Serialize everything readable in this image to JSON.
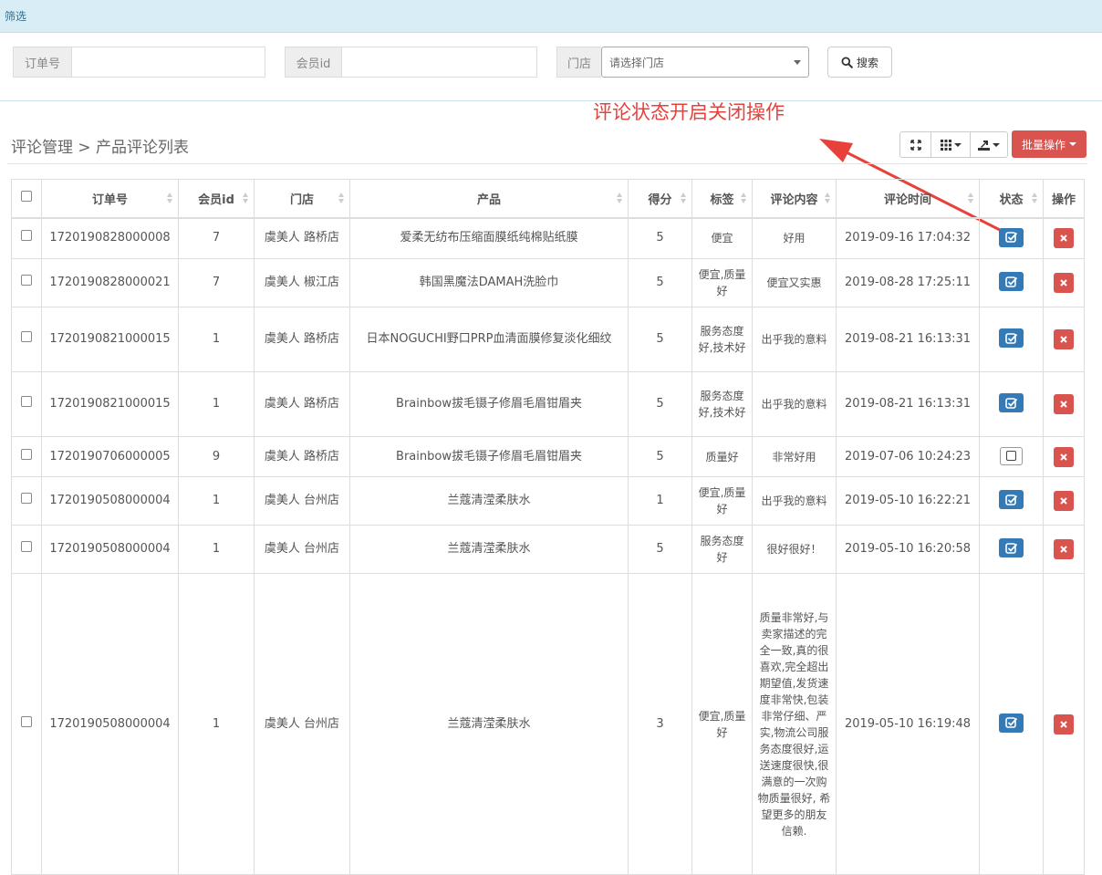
{
  "filter": {
    "header": "筛选",
    "order_label": "订单号",
    "order_value": "",
    "member_label": "会员id",
    "member_value": "",
    "store_label": "门店",
    "store_placeholder": "请选择门店",
    "search_label": "搜索"
  },
  "annotation": "评论状态开启关闭操作",
  "breadcrumb": "评论管理 > 产品评论列表",
  "toolbar": {
    "batch_label": "批量操作"
  },
  "table": {
    "headers": [
      "订单号",
      "会员id",
      "门店",
      "产品",
      "得分",
      "标签",
      "评论内容",
      "评论时间",
      "状态",
      "操作"
    ],
    "rows": [
      {
        "order": "1720190828000008",
        "member": "7",
        "store": "虞美人 路桥店",
        "product": "爱柔无纺布压缩面膜纸纯棉贴纸膜",
        "score": "5",
        "tag": "便宜",
        "content": "好用",
        "time": "2019-09-16 17:04:32",
        "status": true
      },
      {
        "order": "1720190828000021",
        "member": "7",
        "store": "虞美人 椒江店",
        "product": "韩国黑魔法DAMAH洗脸巾",
        "score": "5",
        "tag": "便宜,质量好",
        "content": "便宜又实惠",
        "time": "2019-08-28 17:25:11",
        "status": true
      },
      {
        "order": "1720190821000015",
        "member": "1",
        "store": "虞美人 路桥店",
        "product": "日本NOGUCHI野口PRP血清面膜修复淡化细纹",
        "score": "5",
        "tag": "服务态度好,技术好",
        "content": "出乎我的意料",
        "time": "2019-08-21 16:13:31",
        "status": true
      },
      {
        "order": "1720190821000015",
        "member": "1",
        "store": "虞美人 路桥店",
        "product": "Brainbow拔毛镊子修眉毛眉钳眉夹",
        "score": "5",
        "tag": "服务态度好,技术好",
        "content": "出乎我的意料",
        "time": "2019-08-21 16:13:31",
        "status": true
      },
      {
        "order": "1720190706000005",
        "member": "9",
        "store": "虞美人 路桥店",
        "product": "Brainbow拔毛镊子修眉毛眉钳眉夹",
        "score": "5",
        "tag": "质量好",
        "content": "非常好用",
        "time": "2019-07-06 10:24:23",
        "status": false
      },
      {
        "order": "1720190508000004",
        "member": "1",
        "store": "虞美人 台州店",
        "product": "兰蔻清滢柔肤水",
        "score": "1",
        "tag": "便宜,质量好",
        "content": "出乎我的意料",
        "time": "2019-05-10 16:22:21",
        "status": true
      },
      {
        "order": "1720190508000004",
        "member": "1",
        "store": "虞美人 台州店",
        "product": "兰蔻清滢柔肤水",
        "score": "5",
        "tag": "服务态度好",
        "content": "很好很好！",
        "time": "2019-05-10 16:20:58",
        "status": true
      },
      {
        "order": "1720190508000004",
        "member": "1",
        "store": "虞美人 台州店",
        "product": "兰蔻清滢柔肤水",
        "score": "3",
        "tag": "便宜,质量好",
        "content": "质量非常好,与卖家描述的完全一致,真的很喜欢,完全超出期望值,发货速度非常快,包装非常仔细、严实,物流公司服务态度很好,运送速度很快,很满意的一次购物质量很好, 希望更多的朋友信赖.",
        "time": "2019-05-10 16:19:48",
        "status": true
      }
    ]
  },
  "colors": {
    "header_bg": "#d9edf7",
    "primary": "#337ab7",
    "danger": "#d9534f",
    "annotation": "#e8403a"
  }
}
